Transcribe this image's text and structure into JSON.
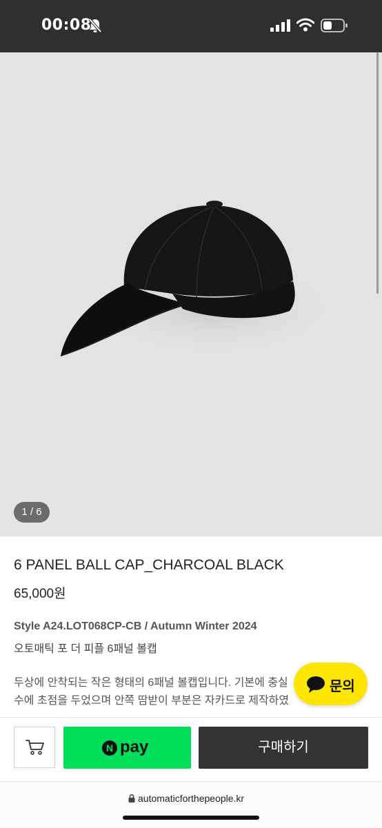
{
  "status_bar": {
    "time": "00:08",
    "icons": [
      "bell-slash-icon",
      "signal-icon",
      "wifi-icon",
      "battery-icon"
    ]
  },
  "gallery": {
    "counter": "1 / 6",
    "image": "black-baseball-cap"
  },
  "product": {
    "title": "6 PANEL BALL CAP_CHARCOAL BLACK",
    "price": "65,000원",
    "style": "Style A24.LOT068CP-CB / Autumn Winter 2024",
    "subtitle": "오토매틱 포 더 피플 6패널 볼캡",
    "description_line1": "두상에 안착되는 작은 형태의 6패널 볼캡입니다. 기본에 충실",
    "description_line2": "수에 초점을 두었으며 안쪽 땀받이 부분은 자카드로 제작하였"
  },
  "inquiry": {
    "label": "문의",
    "icon": "chat-bubble-icon",
    "color": "#fee500"
  },
  "actions": {
    "cart_icon": "cart-icon",
    "npay_badge": "N",
    "npay_label": "pay",
    "npay_color": "#00de5a",
    "buy_label": "구매하기",
    "buy_color": "#333333"
  },
  "browser": {
    "url": "automaticforthepeople.kr",
    "lock_icon": "lock-icon"
  }
}
